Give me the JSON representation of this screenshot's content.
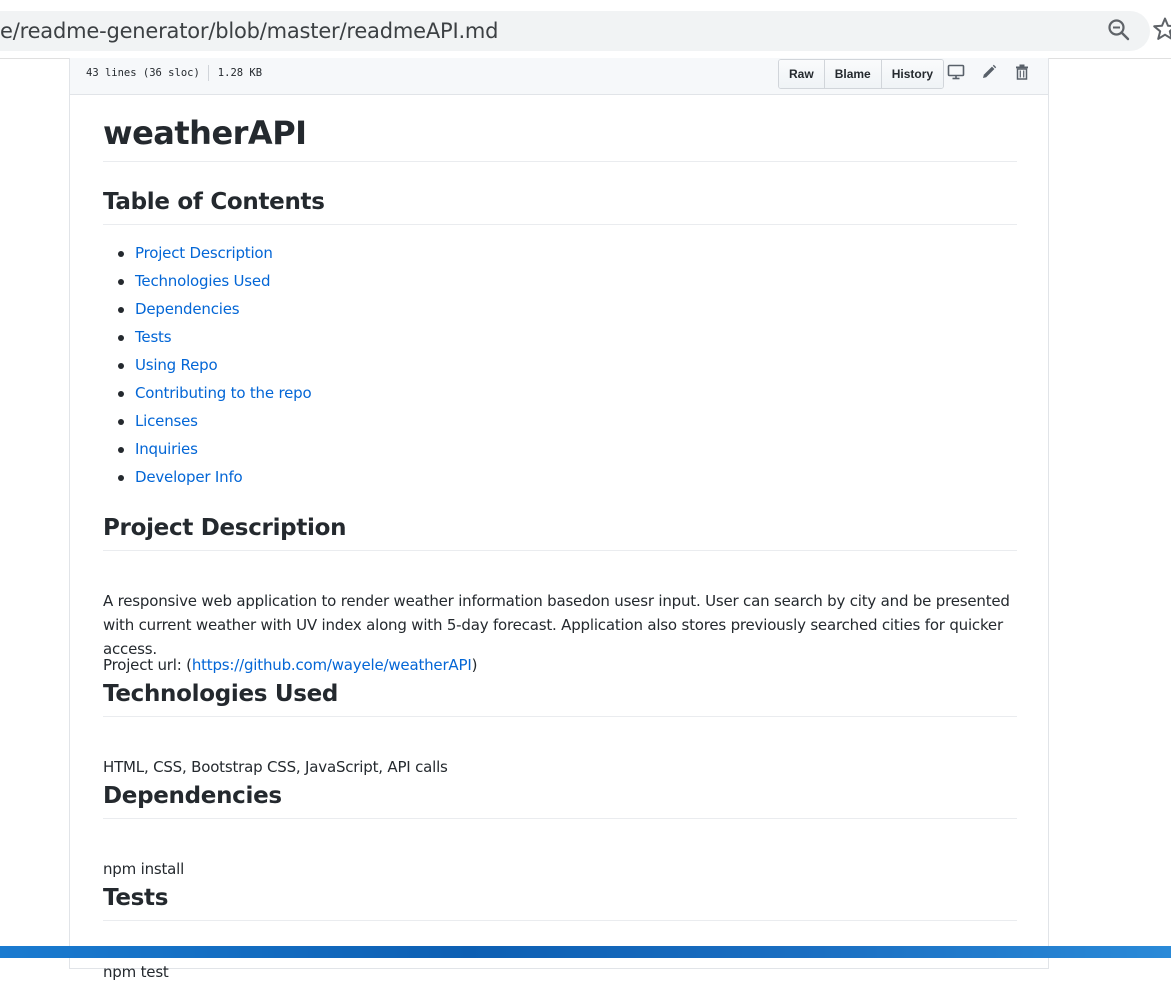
{
  "browser": {
    "url": "e/readme-generator/blob/master/readmeAPI.md",
    "zoom_icon": "zoom-icon",
    "bookmark_icon": "star-icon"
  },
  "file_header": {
    "lines": "43 lines (36 sloc)",
    "size": "1.28 KB",
    "buttons": {
      "raw": "Raw",
      "blame": "Blame",
      "history": "History"
    },
    "icons": [
      "desktop-icon",
      "pencil-icon",
      "trash-icon"
    ]
  },
  "readme": {
    "title": "weatherAPI",
    "toc_heading": "Table of Contents",
    "toc": [
      "Project Description",
      "Technologies Used",
      "Dependencies",
      "Tests",
      "Using Repo",
      "Contributing to the repo",
      "Licenses",
      "Inquiries",
      "Developer Info"
    ],
    "project_description": {
      "heading": "Project Description",
      "text": "A responsive web application to render weather information basedon usesr input. User can search by city and be presented with current weather with UV index along with 5-day forecast. Application also stores previously searched cities for quicker access.",
      "url_prefix": "Project url: (",
      "url": "https://github.com/wayele/weatherAPI",
      "url_suffix": ")"
    },
    "technologies": {
      "heading": "Technologies Used",
      "text": "HTML, CSS, Bootstrap CSS, JavaScript, API calls"
    },
    "dependencies": {
      "heading": "Dependencies",
      "text": "npm install"
    },
    "tests": {
      "heading": "Tests",
      "text": "npm test"
    }
  },
  "colors": {
    "link": "#0366d6",
    "text": "#24292e",
    "taskbar": "#1a7bd0"
  }
}
